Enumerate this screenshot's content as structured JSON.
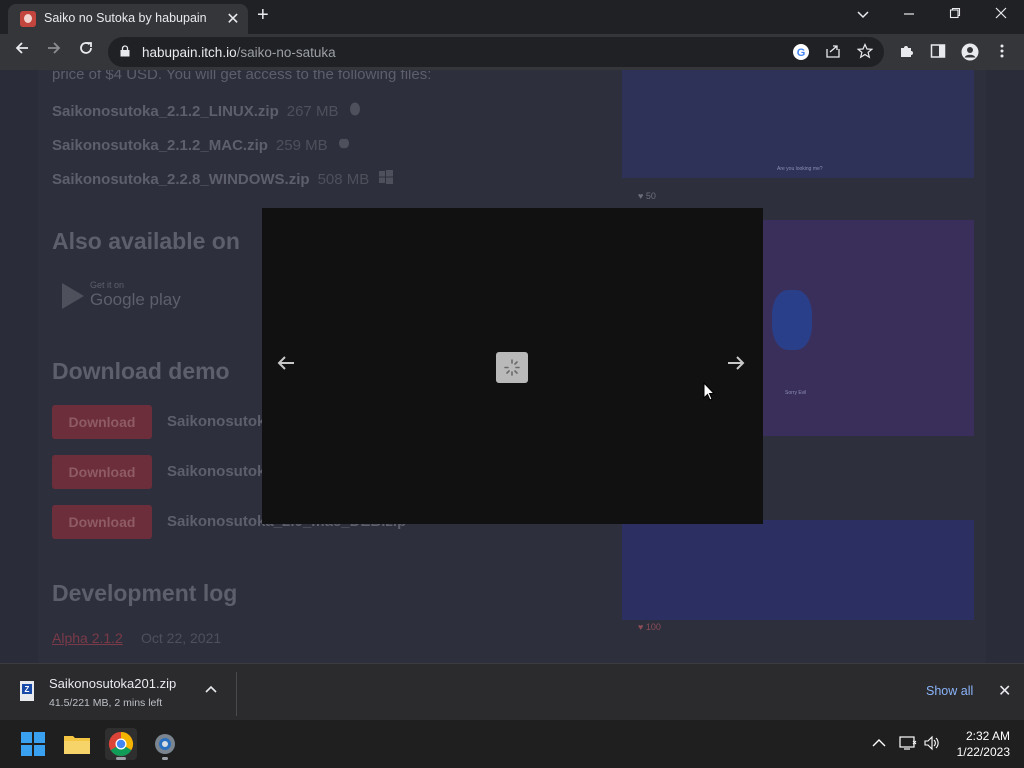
{
  "browser": {
    "tab_title": "Saiko no Sutoka by habupain",
    "tab_close": "✕",
    "new_tab": "+",
    "url_host": "habupain.itch.io",
    "url_path": "/saiko-no-satuka"
  },
  "page": {
    "price_text": "price of $4 USD. You will get access to the following files:",
    "files": [
      {
        "name": "Saikonosutoka_2.1.2_LINUX.zip",
        "size": "267 MB",
        "icon": "linux-icon"
      },
      {
        "name": "Saikonosutoka_2.1.2_MAC.zip",
        "size": "259 MB",
        "icon": "apple-icon"
      },
      {
        "name": "Saikonosutoka_2.2.8_WINDOWS.zip",
        "size": "508 MB",
        "icon": "windows-icon"
      }
    ],
    "also_available_heading": "Also available on",
    "google_play_small": "Get it on",
    "google_play_big": "Google play",
    "download_demo_heading": "Download demo",
    "demo_button_label": "Download",
    "demo_files": [
      "Saikonosutok",
      "Saikonosutok",
      "Saikonosutoka_2.0_mac_DEB.zip"
    ],
    "devlog_heading": "Development log",
    "devlog_link": "Alpha 2.1.2",
    "devlog_date": "Oct 22, 2021",
    "like_count_top": "50",
    "like_count_bottom": "100",
    "shot_caption_1": "Are you looking me?",
    "shot_caption_2": "Sorry Evil"
  },
  "lightbox": {
    "prev_arrow": "←",
    "next_arrow": "→"
  },
  "download_bar": {
    "filename": "Saikonosutoka201.zip",
    "status": "41.5/221 MB, 2 mins left",
    "show_all": "Show all",
    "close": "✕"
  },
  "taskbar": {
    "time": "2:32 AM",
    "date": "1/22/2023"
  }
}
